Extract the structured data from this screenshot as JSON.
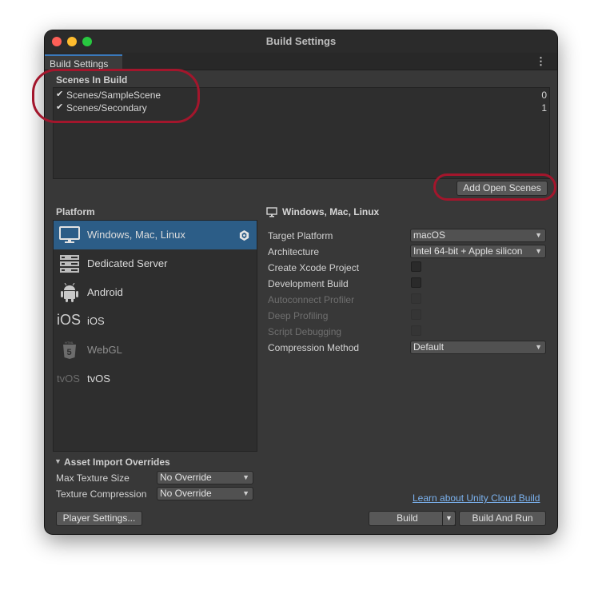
{
  "window": {
    "title": "Build Settings"
  },
  "tab": {
    "label": "Build Settings",
    "menu_icon": "kebab-menu-icon"
  },
  "scenes": {
    "header": "Scenes In Build",
    "items": [
      {
        "name": "Scenes/SampleScene",
        "index": "0",
        "checked": true
      },
      {
        "name": "Scenes/Secondary",
        "index": "1",
        "checked": true
      }
    ],
    "add_open_scenes_label": "Add Open Scenes"
  },
  "platform": {
    "header": "Platform",
    "items": [
      {
        "label": "Windows, Mac, Linux",
        "icon": "monitor-icon",
        "selected": true,
        "active_badge": "unity-logo-icon"
      },
      {
        "label": "Dedicated Server",
        "icon": "server-icon"
      },
      {
        "label": "Android",
        "icon": "android-icon"
      },
      {
        "label": "iOS",
        "icon": "ios-icon",
        "icon_text": "iOS"
      },
      {
        "label": "WebGL",
        "icon": "html5-icon",
        "dimmed": true
      },
      {
        "label": "tvOS",
        "icon": "tvos-icon",
        "icon_text": "tvOS"
      }
    ]
  },
  "settings": {
    "header": "Windows, Mac, Linux",
    "target_platform": {
      "label": "Target Platform",
      "value": "macOS"
    },
    "architecture": {
      "label": "Architecture",
      "value": "Intel 64-bit + Apple silicon"
    },
    "create_xcode": {
      "label": "Create Xcode Project",
      "checked": false
    },
    "development_build": {
      "label": "Development Build",
      "checked": false
    },
    "autoconnect_profiler": {
      "label": "Autoconnect Profiler",
      "disabled": true
    },
    "deep_profiling": {
      "label": "Deep Profiling",
      "disabled": true
    },
    "script_debugging": {
      "label": "Script Debugging",
      "disabled": true
    },
    "compression": {
      "label": "Compression Method",
      "value": "Default"
    }
  },
  "asset_overrides": {
    "header": "Asset Import Overrides",
    "max_texture_size": {
      "label": "Max Texture Size",
      "value": "No Override"
    },
    "texture_compression": {
      "label": "Texture Compression",
      "value": "No Override"
    }
  },
  "footer": {
    "player_settings_label": "Player Settings...",
    "cloud_build_link": "Learn about Unity Cloud Build",
    "build_label": "Build",
    "build_and_run_label": "Build And Run"
  },
  "colors": {
    "window_bg": "#383838",
    "selection": "#2c5d87",
    "link": "#7bb2ef",
    "highlight_ring": "#a3162c"
  }
}
